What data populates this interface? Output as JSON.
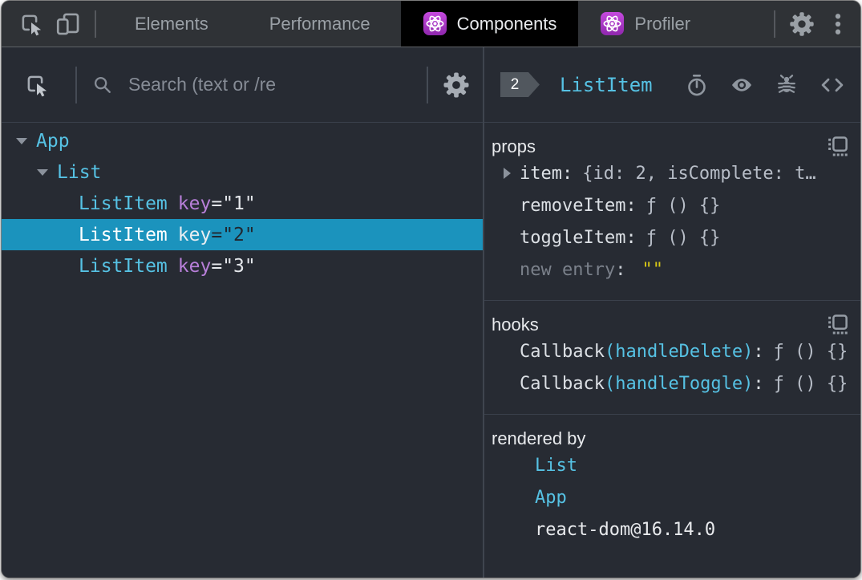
{
  "strings": {
    "colon": ":",
    "eq": "="
  },
  "colors": {
    "accent_cyan": "#56c2e4",
    "selected_row_teal": "#1b93bd",
    "react_logo_purple": "#a63fc2",
    "attribute_purple": "#b87fd9",
    "editable_value_yellow": "#d9c916",
    "panel_background": "#272b33",
    "active_tab_background": "#000000"
  },
  "topbar": {
    "tabs": {
      "elements": "Elements",
      "performance": "Performance",
      "components": "Components",
      "profiler": "Profiler"
    }
  },
  "left_panel": {
    "search_placeholder": "Search (text or /re",
    "tree": {
      "rows": [
        {
          "name": "App"
        },
        {
          "name": "List"
        },
        {
          "name": "ListItem",
          "attr": "key",
          "value": "\"1\""
        },
        {
          "name": "ListItem",
          "attr": "key",
          "value": "\"2\"",
          "selected": true
        },
        {
          "name": "ListItem",
          "attr": "key",
          "value": "\"3\""
        }
      ]
    }
  },
  "right_panel": {
    "header": {
      "badge": "2",
      "title": "ListItem"
    },
    "props": {
      "label": "props",
      "rows": [
        {
          "name": "item",
          "value": "{id: 2, isComplete: t…"
        },
        {
          "name": "removeItem",
          "value": "ƒ () {}"
        },
        {
          "name": "toggleItem",
          "value": "ƒ () {}"
        },
        {
          "name": "new entry",
          "value": "\"\""
        }
      ]
    },
    "hooks": {
      "label": "hooks",
      "rows": [
        {
          "name": "Callback",
          "target": "(handleDelete)",
          "value": "ƒ () {}"
        },
        {
          "name": "Callback",
          "target": "(handleToggle)",
          "value": "ƒ () {}"
        }
      ]
    },
    "rendered_by": {
      "label": "rendered by",
      "items": [
        {
          "label": "List"
        },
        {
          "label": "App"
        },
        {
          "label": "react-dom@16.14.0"
        }
      ]
    }
  }
}
